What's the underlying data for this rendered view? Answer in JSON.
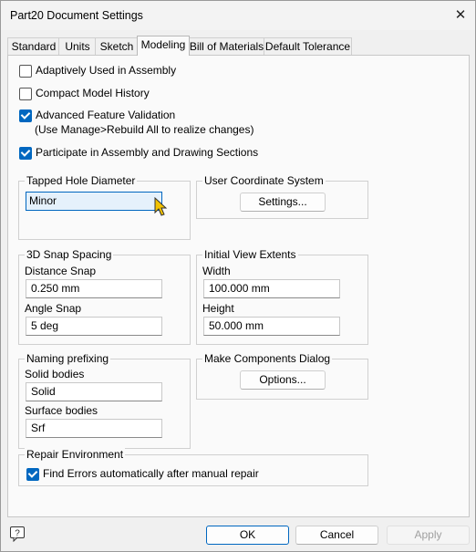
{
  "window": {
    "title": "Part20 Document Settings",
    "close_glyph": "✕"
  },
  "tabs": [
    {
      "label": "Standard"
    },
    {
      "label": "Units"
    },
    {
      "label": "Sketch"
    },
    {
      "label": "Modeling",
      "active": true
    },
    {
      "label": "Bill of Materials"
    },
    {
      "label": "Default Tolerance"
    }
  ],
  "options": {
    "adaptively_used": {
      "label": "Adaptively Used in Assembly",
      "checked": false
    },
    "compact_history": {
      "label": "Compact Model History",
      "checked": false
    },
    "advanced_validation": {
      "label": "Advanced Feature Validation",
      "checked": true,
      "note": "(Use Manage>Rebuild All to realize changes)"
    },
    "participate": {
      "label": "Participate in Assembly and Drawing Sections",
      "checked": true
    }
  },
  "tapped_hole": {
    "title": "Tapped Hole Diameter",
    "value": "Minor"
  },
  "ucs": {
    "title": "User Coordinate System",
    "button": "Settings..."
  },
  "snap": {
    "title": "3D Snap Spacing",
    "distance_label": "Distance Snap",
    "distance_value": "0.250 mm",
    "angle_label": "Angle Snap",
    "angle_value": "5 deg"
  },
  "view_extents": {
    "title": "Initial View Extents",
    "width_label": "Width",
    "width_value": "100.000 mm",
    "height_label": "Height",
    "height_value": "50.000 mm"
  },
  "naming": {
    "title": "Naming prefixing",
    "solid_label": "Solid bodies",
    "solid_value": "Solid",
    "surface_label": "Surface bodies",
    "surface_value": "Srf"
  },
  "make_components": {
    "title": "Make Components Dialog",
    "button": "Options..."
  },
  "repair": {
    "title": "Repair Environment",
    "label": "Find Errors automatically after manual repair",
    "checked": true
  },
  "footer": {
    "ok": "OK",
    "cancel": "Cancel",
    "apply": "Apply",
    "help_icon": "help-icon"
  },
  "colors": {
    "accent": "#0067c0",
    "cursor": "#f2c200"
  }
}
